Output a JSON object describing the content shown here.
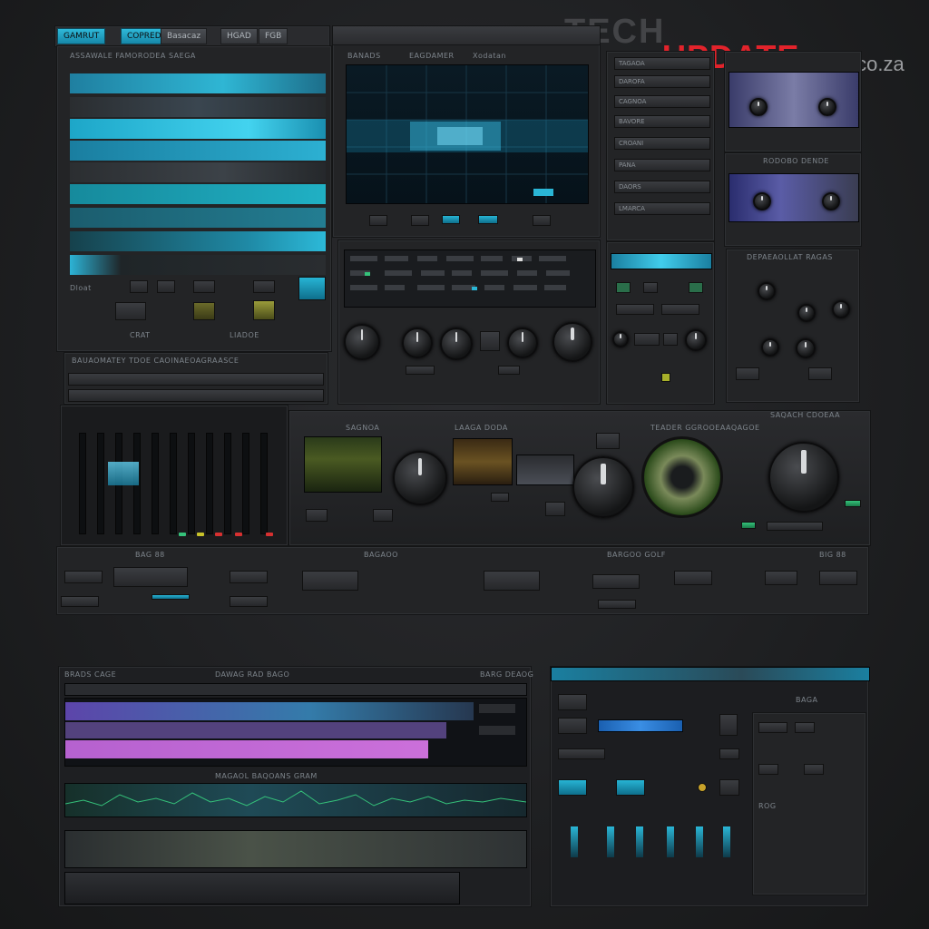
{
  "watermark": {
    "tech": "TECH",
    "update": "UPDATE",
    "domain": ".co.za"
  },
  "colors": {
    "accent": "#2ab6d6",
    "brand_red": "#e2232b",
    "purple": "#a05ee0",
    "green": "#35c27a"
  },
  "top_tabs": [
    "GAMRUT",
    "COPRED",
    "Basacaz",
    "HGAD",
    "FGB"
  ],
  "playlist_panel": {
    "header": "ASSAWALE FAMORODEA SAEGA",
    "footer_title": "BAUAOMATEY TDOE CAOINAEOAGRAASCE",
    "row_labels": [
      "Dloat",
      "CRAT",
      "LIADOE"
    ]
  },
  "spectrum_panel": {
    "header_left": "BANADS",
    "header_mid": "EAGDAMER",
    "header_right": "Xodatan"
  },
  "side_list": {
    "items": [
      "TAGAOA",
      "DAROFA",
      "CAGNOA",
      "BAVORE",
      "CROANI",
      "PANA",
      "DAORS",
      "LMARCA"
    ]
  },
  "right_panel": {
    "cam_title": "RODOBO DENDE",
    "group_title": "DEPAEAOLLAT RAGAS"
  },
  "mixer": {
    "labels": [
      "SAGNOA",
      "LAAGA DODA",
      "TEADER GGROOEAAQAGOE",
      "SAQACH CDOEAA"
    ],
    "bottom_labels": [
      "BAG 88",
      "BAGAOO",
      "BARGOO GOLF",
      "BIG 88"
    ]
  },
  "waveform_panel": {
    "header_left": "BRADS CAGE",
    "header_mid": "DAWAG RAD BAGO",
    "header_right": "BARG DEAOG",
    "sub_label": "MAGAOL BAQOANS GRAM"
  },
  "utility_panel": {
    "title": "ROG",
    "badge": "BAGA"
  }
}
